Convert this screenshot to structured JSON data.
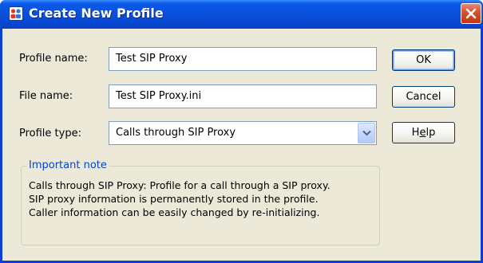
{
  "window": {
    "title": "Create New Profile",
    "icon": "profile-icon",
    "close_icon": "close-icon"
  },
  "form": {
    "profile_name": {
      "label": "Profile name:",
      "value": "Test SIP Proxy"
    },
    "file_name": {
      "label": "File name:",
      "value": "Test SIP Proxy.ini"
    },
    "profile_type": {
      "label": "Profile type:",
      "selected": "Calls through SIP Proxy",
      "dropdown_icon": "chevron-down-icon"
    }
  },
  "buttons": {
    "ok": "OK",
    "cancel": "Cancel",
    "help_prefix": "H",
    "help_underlined": "e",
    "help_suffix": "lp"
  },
  "note": {
    "title": "Important note",
    "lines": [
      "Calls through SIP Proxy: Profile for a call through a SIP proxy.",
      "SIP proxy information is permanently stored in the profile.",
      "Caller information can be easily changed by re-initializing."
    ]
  },
  "colors": {
    "titlebar": "#0a4fdc",
    "dialog_bg": "#ece9d8",
    "close_button": "#d8532e",
    "group_title": "#0046d5"
  }
}
